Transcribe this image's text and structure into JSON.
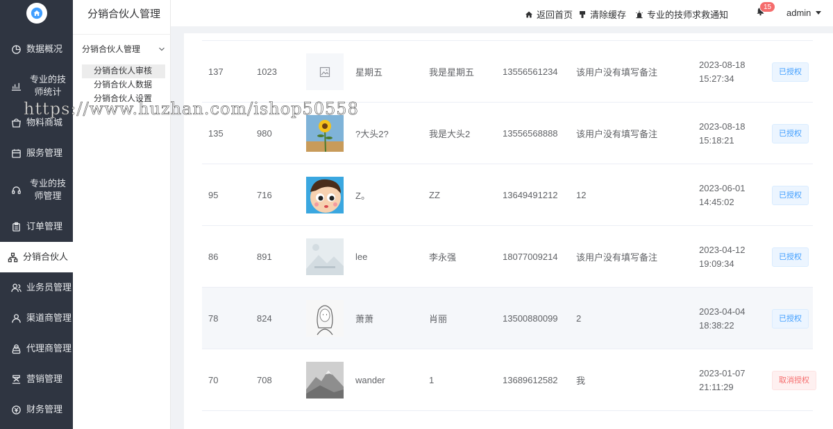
{
  "app": {
    "logo_icon": "home-icon"
  },
  "nav": {
    "items": [
      {
        "label": "数据概况",
        "icon": "pie-chart-icon"
      },
      {
        "label": "专业的技师统计",
        "icon": "bar-chart-icon"
      },
      {
        "label": "物料商城",
        "icon": "shop-icon"
      },
      {
        "label": "服务管理",
        "icon": "calendar-icon"
      },
      {
        "label": "专业的技师管理",
        "icon": "headset-icon"
      },
      {
        "label": "订单管理",
        "icon": "clipboard-icon"
      },
      {
        "label": "分销合伙人",
        "icon": "network-icon",
        "active": true
      },
      {
        "label": "业务员管理",
        "icon": "users-icon"
      },
      {
        "label": "渠道商管理",
        "icon": "user-icon"
      },
      {
        "label": "代理商管理",
        "icon": "user-group-icon"
      },
      {
        "label": "营销管理",
        "icon": "marketing-icon"
      },
      {
        "label": "财务管理",
        "icon": "finance-icon"
      }
    ]
  },
  "submenu": {
    "title": "分销合伙人管理",
    "group_label": "分销合伙人管理",
    "items": [
      {
        "label": "分销合伙人审核",
        "active": true
      },
      {
        "label": "分销合伙人数据"
      },
      {
        "label": "分销合伙人设置"
      }
    ]
  },
  "header": {
    "home_label": "返回首页",
    "clear_cache_label": "清除缓存",
    "notice_label": "专业的技师求救通知",
    "badge_count": "15",
    "user_name": "admin"
  },
  "table": {
    "rows": [
      {
        "id": "137",
        "uid": "1023",
        "avatar": "placeholder-image-icon",
        "nickname": "星期五",
        "name": "我是星期五",
        "phone": "13556561234",
        "remark": "该用户没有填写备注",
        "date": "2023-08-18",
        "time": "15:27:34",
        "action": "已授权",
        "action_type": "authorized"
      },
      {
        "id": "135",
        "uid": "980",
        "avatar": "sunflower-photo",
        "nickname": "?大头2?",
        "name": "我是大头2",
        "phone": "13556568888",
        "remark": "该用户没有填写备注",
        "date": "2023-08-18",
        "time": "15:18:21",
        "action": "已授权",
        "action_type": "authorized"
      },
      {
        "id": "95",
        "uid": "716",
        "avatar": "cartoon-face",
        "nickname": "Z。",
        "name": "ZZ",
        "phone": "13649491212",
        "remark": "12",
        "date": "2023-06-01",
        "time": "14:45:02",
        "action": "已授权",
        "action_type": "authorized"
      },
      {
        "id": "86",
        "uid": "891",
        "avatar": "default-landscape",
        "nickname": "lee",
        "name": "李永强",
        "phone": "18077009214",
        "remark": "该用户没有填写备注",
        "date": "2023-04-12",
        "time": "19:09:34",
        "action": "已授权",
        "action_type": "authorized"
      },
      {
        "id": "78",
        "uid": "824",
        "avatar": "sketch-girl",
        "nickname": "萧萧",
        "name": "肖丽",
        "phone": "13500880099",
        "remark": "2",
        "date": "2023-04-04",
        "time": "18:38:22",
        "action": "已授权",
        "action_type": "authorized",
        "hover": true
      },
      {
        "id": "70",
        "uid": "708",
        "avatar": "mountain-photo",
        "nickname": "wander",
        "name": "1",
        "phone": "13689612582",
        "remark": "我",
        "date": "2023-01-07",
        "time": "21:11:29",
        "action": "取消授权",
        "action_type": "revoke"
      }
    ]
  },
  "watermark": "https://www.huzhan.com/ishop50558",
  "colors": {
    "sidebar": "#2f3541",
    "primary": "#409eff",
    "danger": "#f56c6c"
  }
}
